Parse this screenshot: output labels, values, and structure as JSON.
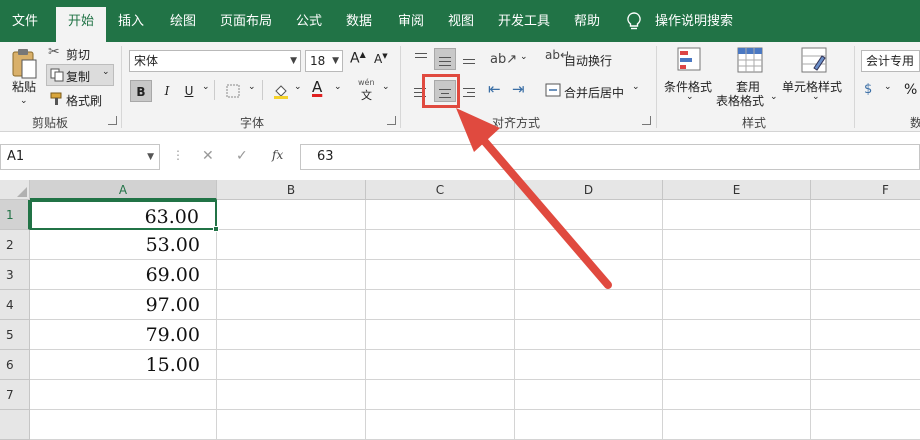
{
  "menu": {
    "tabs": [
      "文件",
      "开始",
      "插入",
      "绘图",
      "页面布局",
      "公式",
      "数据",
      "审阅",
      "视图",
      "开发工具",
      "帮助"
    ],
    "active": "开始",
    "search": "操作说明搜索"
  },
  "ribbon": {
    "clipboard": {
      "paste": "粘贴",
      "cut": "剪切",
      "copy": "复制",
      "format_painter": "格式刷",
      "label": "剪贴板"
    },
    "font": {
      "name": "宋体",
      "size": "18",
      "bold": "B",
      "italic": "I",
      "underline": "U",
      "label": "字体",
      "phonetic_top": "wén",
      "phonetic_bottom": "文"
    },
    "alignment": {
      "wrap_text": "自动换行",
      "merge_center": "合并后居中",
      "label": "对齐方式"
    },
    "styles": {
      "conditional": "条件格式",
      "table_1": "套用",
      "table_2": "表格格式",
      "cell_styles": "单元格样式",
      "label": "样式"
    },
    "number": {
      "format": "会计专用",
      "label": "数",
      "percent": "%"
    }
  },
  "formula_bar": {
    "name_box": "A1",
    "cancel": "✕",
    "enter": "✓",
    "fx": "fx",
    "value": "63"
  },
  "sheet": {
    "columns": [
      "A",
      "B",
      "C",
      "D",
      "E",
      "F"
    ],
    "rows": [
      "1",
      "2",
      "3",
      "4",
      "5",
      "6",
      "7"
    ],
    "values_a": [
      "63.00",
      "53.00",
      "69.00",
      "97.00",
      "79.00",
      "15.00",
      ""
    ]
  },
  "colors": {
    "brand": "#217346",
    "annotation": "#e04a3f"
  }
}
